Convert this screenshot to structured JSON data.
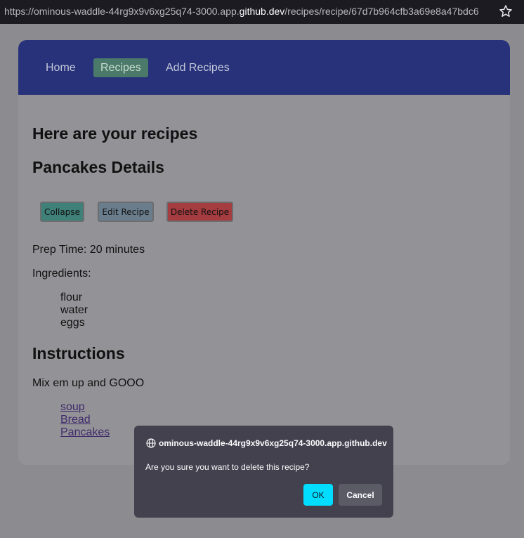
{
  "browser": {
    "url_prefix": "https://ominous-waddle-44rg9x9v6xg25q74-3000.app.",
    "url_host": "github.dev",
    "url_path": "/recipes/recipe/67d7b964cfb3a69e8a47bdc6",
    "bookmark_icon": "star-icon"
  },
  "nav": {
    "items": [
      {
        "label": "Home"
      },
      {
        "label": "Recipes",
        "active": true
      },
      {
        "label": "Add Recipes"
      }
    ],
    "bar_color": "#27327a"
  },
  "main": {
    "heading": "Here are your recipes",
    "detail_title": "Pancakes Details",
    "buttons": {
      "collapse": "Collapse",
      "edit": "Edit Recipe",
      "delete": "Delete Recipe"
    },
    "prep_time": "Prep Time: 20 minutes",
    "ingredients_label": "Ingredients:",
    "ingredients": [
      "flour",
      "water",
      "eggs"
    ],
    "instructions_title": "Instructions",
    "instructions": "Mix em up and GOOO",
    "recipe_links": [
      "soup",
      "Bread",
      "Pancakes"
    ]
  },
  "dialog": {
    "origin": "ominous-waddle-44rg9x9v6xg25q74-3000.app.github.dev",
    "message": "Are you sure you want to delete this recipe?",
    "ok_label": "OK",
    "cancel_label": "Cancel",
    "ok_color": "#00ddff"
  }
}
